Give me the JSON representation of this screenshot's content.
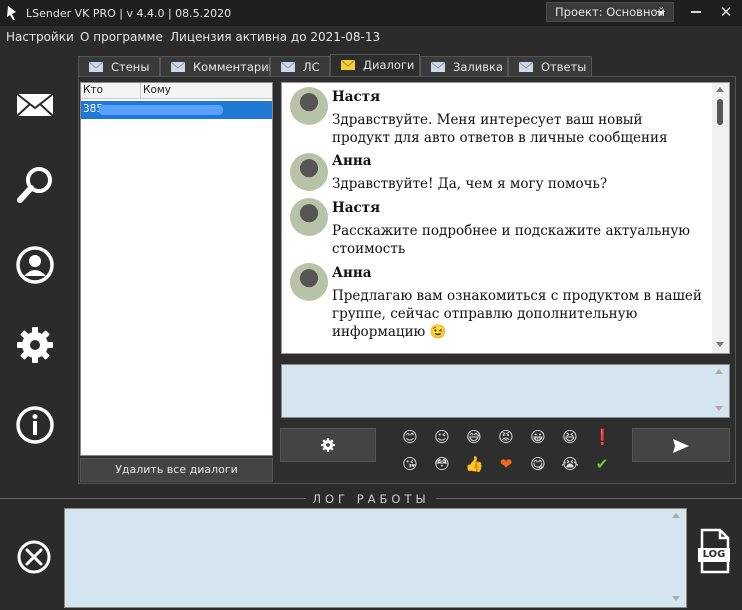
{
  "window": {
    "title": "LSender VK PRO | v 4.4.0 | 08.5.2020",
    "project_label": "Проект: Основной",
    "close_glyph": "✕"
  },
  "menu": {
    "items": [
      "Настройки",
      "О программе",
      "Лицензия активна до 2021-08-13"
    ]
  },
  "sidebar": {
    "icons": [
      "envelope-icon",
      "search-icon",
      "user-icon",
      "gear-icon",
      "info-icon"
    ]
  },
  "tabs": [
    {
      "label": "Стены",
      "active": false
    },
    {
      "label": "Комментарии",
      "active": false
    },
    {
      "label": "ЛС",
      "active": false
    },
    {
      "label": "Диалоги",
      "active": true
    },
    {
      "label": "Заливка",
      "active": false
    },
    {
      "label": "Ответы",
      "active": false
    }
  ],
  "dialog_list": {
    "columns": [
      "Кто",
      "Кому"
    ],
    "rows": [
      {
        "from": "385"
      }
    ],
    "delete_all_label": "Удалить все диалоги"
  },
  "chat": {
    "messages": [
      {
        "name": "Настя",
        "text": "Здравствуйте. Меня интересует ваш новый продукт для авто ответов в личные сообщения"
      },
      {
        "name": "Анна",
        "text": "Здравствуйте! Да, чем я могу помочь?"
      },
      {
        "name": "Настя",
        "text": "Расскажите подробнее и подскажите актуальную стоимость"
      },
      {
        "name": "Анна",
        "text": "Предлагаю вам ознакомиться с продуктом в нашей группе, сейчас отправлю дополнительную информацию 😉"
      }
    ]
  },
  "emojis": [
    "😊",
    "😉",
    "😅",
    "😡",
    "😀",
    "😆",
    "❗",
    "😘",
    "😳",
    "👍",
    "❤",
    "😋",
    "😭",
    "✔"
  ],
  "log": {
    "title": "ЛОГ РАБОТЫ",
    "file_icon_label": "LOG"
  },
  "colors": {
    "accent": "#1e78d4",
    "input_bg": "#d5e5ef",
    "window_bg": "#2b2b2b"
  }
}
